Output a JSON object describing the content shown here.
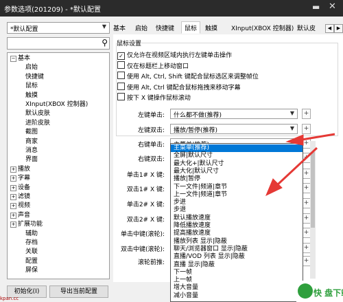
{
  "window": {
    "title": "参数选项(201209) - *默认配置",
    "pin_icon": "pin-icon",
    "close_icon": "close-icon"
  },
  "profile": {
    "selected": "*默认配置"
  },
  "search": {
    "value": "",
    "icon": "search-icon"
  },
  "tree": [
    {
      "label": "基本",
      "expand": "−"
    },
    {
      "label": "启始",
      "expand": ""
    },
    {
      "label": "快捷键",
      "expand": ""
    },
    {
      "label": "鼠标",
      "expand": ""
    },
    {
      "label": "触摸",
      "expand": ""
    },
    {
      "label": "XInput(XBOX 控制器)",
      "expand": ""
    },
    {
      "label": "默认皮肤",
      "expand": ""
    },
    {
      "label": "进阶皮肤",
      "expand": ""
    },
    {
      "label": "截图",
      "expand": ""
    },
    {
      "label": "商家",
      "expand": ""
    },
    {
      "label": "消息",
      "expand": ""
    },
    {
      "label": "界面",
      "expand": ""
    },
    {
      "label": "播放",
      "expand": "+"
    },
    {
      "label": "字幕",
      "expand": "+"
    },
    {
      "label": "设备",
      "expand": "+"
    },
    {
      "label": "滤镜",
      "expand": "+"
    },
    {
      "label": "视频",
      "expand": "+"
    },
    {
      "label": "声音",
      "expand": "+"
    },
    {
      "label": "扩展功能",
      "expand": "+"
    },
    {
      "label": "辅助",
      "expand": ""
    },
    {
      "label": "存档",
      "expand": ""
    },
    {
      "label": "关联",
      "expand": ""
    },
    {
      "label": "配置",
      "expand": ""
    },
    {
      "label": "屏保",
      "expand": ""
    }
  ],
  "tabs": [
    "基本",
    "启始",
    "快捷键",
    "鼠标",
    "触摸",
    "XInput(XBOX 控制器)",
    "默认皮"
  ],
  "selected_tab": "鼠标",
  "group_title": "鼠标设置",
  "checkboxes": [
    {
      "label": "仅允许在视频区域内执行左键单击操作",
      "checked": "✓"
    },
    {
      "label": "仅在标题栏上移动窗口",
      "checked": ""
    },
    {
      "label": "使用 Alt, Ctrl, Shift 键配合鼠标选区来调整帧位",
      "checked": ""
    },
    {
      "label": "使用 Alt, Ctrl 键配合鼠标拖拽来移动字幕",
      "checked": ""
    },
    {
      "label": "按下 X 键操作鼠标滚动",
      "checked": ""
    }
  ],
  "actions": [
    {
      "label": "左键单击:",
      "value": "什么都不做(推荐)"
    },
    {
      "label": "左键双击:",
      "value": "播放/暂停(推荐)"
    },
    {
      "label": "右键单击:",
      "value": "主菜单(推荐)"
    },
    {
      "label": "右键双击:",
      "value": ""
    },
    {
      "label": "单击1# X 键:",
      "value": ""
    },
    {
      "label": "双击1# X 键:",
      "value": ""
    },
    {
      "label": "单击2# X 键:",
      "value": ""
    },
    {
      "label": "双击2# X 键:",
      "value": ""
    },
    {
      "label": "单击中键(滚轮):",
      "value": ""
    },
    {
      "label": "双击中键(滚轮):",
      "value": ""
    },
    {
      "label": "滚轮前推:",
      "value": ""
    }
  ],
  "small_buttons": {
    "more": "...",
    "plus": "+"
  },
  "dropdown_items": [
    "主菜单(推荐)",
    "全屏|默认尺寸",
    "最大化+|默认尺寸",
    "最大化|默认尺寸",
    "播放|暂停",
    "下一文件|频道|章节",
    "上一文件|频道|章节",
    "步进",
    "步退",
    "默认播放速度",
    "降低播放速度",
    "提高播放速度",
    "播放列表 显示|隐蔽",
    "聊天/浏览器窗口 显示|隐蔽",
    "直播/VOD 列表 显示|隐蔽",
    "直播 显示|隐蔽",
    "下一帧",
    "上一帧",
    "增大音量",
    "减小音量"
  ],
  "dropdown_selected": "主菜单(推荐)",
  "footer": {
    "init_button": "初始化(I)",
    "export_button": "导出当前配置"
  },
  "watermark": {
    "text": "快 盘下载",
    "badge": "快"
  },
  "colors": {
    "titlebar": "#2b2b2b",
    "selection": "#0078d7",
    "arrow": "#e53935",
    "watermark": "#2f9f3d"
  }
}
